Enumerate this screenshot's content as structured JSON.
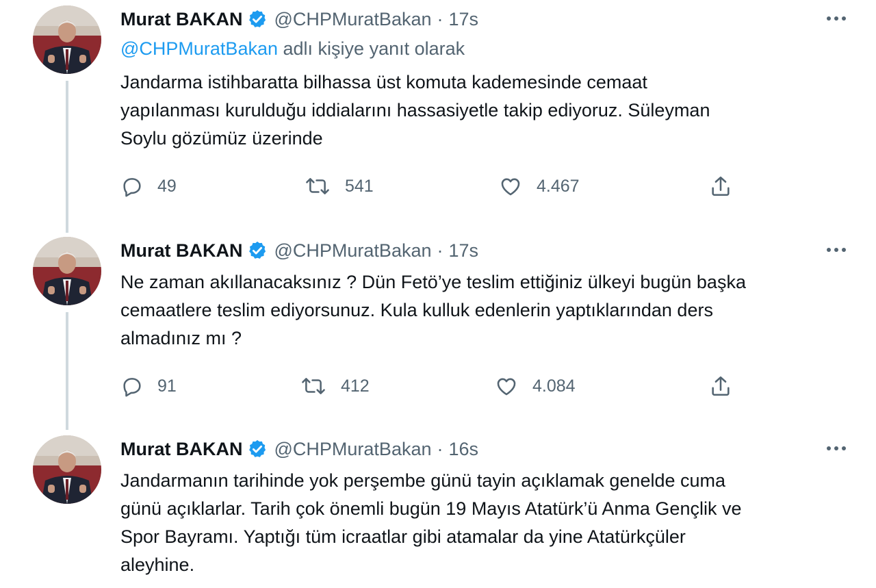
{
  "accent_color": "#1d9bf0",
  "tweets": [
    {
      "name": "Murat BAKAN",
      "handle": "@CHPMuratBakan",
      "separator": "·",
      "time": "17s",
      "reply_prefix": "@CHPMuratBakan",
      "reply_suffix": "adlı kişiye yanıt olarak",
      "lines": [
        "Jandarma istihbaratta bilhassa üst komuta kademesinde cemaat",
        "yapılanması kurulduğu iddialarını hassasiyetle takip ediyoruz. Süleyman",
        "Soylu gözümüz üzerinde"
      ],
      "replies": "49",
      "retweets": "541",
      "likes": "4.467"
    },
    {
      "name": "Murat BAKAN",
      "handle": "@CHPMuratBakan",
      "separator": "·",
      "time": "17s",
      "lines": [
        "Ne zaman akıllanacaksınız ? Dün Fetö’ye teslim ettiğiniz ülkeyi bugün başka",
        "cemaatlere teslim ediyorsunuz.  Kula kulluk edenlerin yaptıklarından ders",
        "almadınız mı ?"
      ],
      "replies": "91",
      "retweets": "412",
      "likes": "4.084"
    },
    {
      "name": "Murat BAKAN",
      "handle": "@CHPMuratBakan",
      "separator": "·",
      "time": "16s",
      "lines": [
        "Jandarmanın tarihinde yok perşembe günü tayin açıklamak genelde cuma",
        "günü açıklarlar. Tarih çok önemli bugün 19 Mayıs Atatürk’ü Anma Gençlik ve",
        "Spor Bayramı. Yaptığı tüm icraatlar gibi atamalar da yine Atatürkçüler",
        "aleyhine."
      ]
    }
  ],
  "icons": {
    "verified": "verified-badge-icon",
    "more": "more-options-icon",
    "reply": "reply-icon",
    "retweet": "retweet-icon",
    "like": "like-icon",
    "share": "share-icon"
  }
}
